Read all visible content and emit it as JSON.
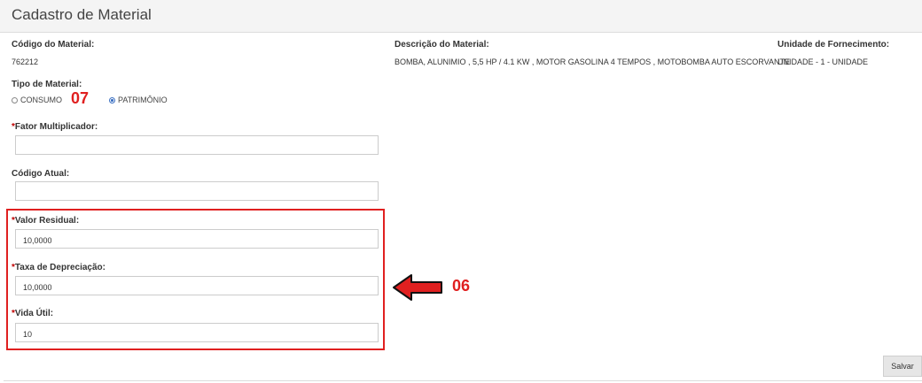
{
  "header": {
    "title": "Cadastro de Material"
  },
  "material": {
    "codigo_label": "Código do Material:",
    "codigo_value": "762212",
    "descricao_label": "Descrição do Material:",
    "descricao_value": "BOMBA, ALUNIMIO , 5,5 HP / 4.1 KW , MOTOR GASOLINA 4 TEMPOS , MOTOBOMBA AUTO ESCORVANTE",
    "unidade_label": "Unidade de Fornecimento:",
    "unidade_value": "UNIDADE - 1 - UNIDADE"
  },
  "tipo": {
    "label": "Tipo de Material:",
    "options": [
      {
        "label": "CONSUMO",
        "selected": false
      },
      {
        "label": "PATRIMÔNIO",
        "selected": true
      }
    ]
  },
  "fields": {
    "required_mark": "*",
    "fator_label": "Fator Multiplicador:",
    "fator_value": "",
    "codigo_atual_label": "Código Atual:",
    "codigo_atual_value": "",
    "valor_residual_label": "Valor Residual:",
    "valor_residual_value": "10,0000",
    "taxa_label": "Taxa de Depreciação:",
    "taxa_value": "10,0000",
    "vida_label": "Vida Útil:",
    "vida_value": "10"
  },
  "annotations": {
    "num_07": "07",
    "num_06": "06",
    "color": "#e02020"
  },
  "actions": {
    "save_label": "Salvar"
  }
}
